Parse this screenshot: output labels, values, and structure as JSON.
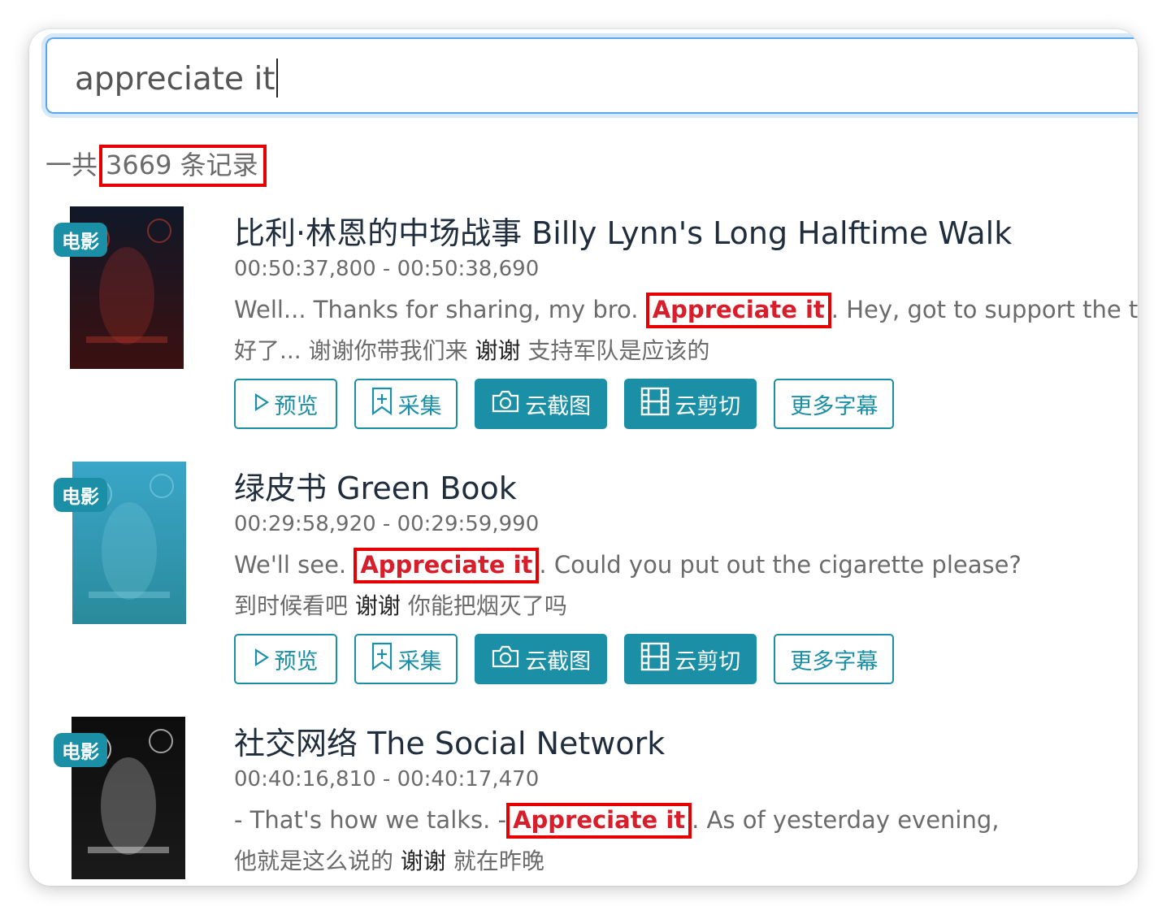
{
  "search": {
    "query": "appreciate it"
  },
  "summary": {
    "prefix": "一共",
    "count_text": "3669 条记录"
  },
  "badge_label": "电影",
  "buttons": {
    "preview": "预览",
    "collect": "采集",
    "screenshot": "云截图",
    "clip": "云剪切",
    "more": "更多字幕"
  },
  "results": [
    {
      "title": "比利·林恩的中场战事 Billy Lynn's Long Halftime Walk",
      "time": "00:50:37,800 - 00:50:38,690",
      "en_before": "Well... Thanks for sharing, my bro. ",
      "en_match": "Appreciate it",
      "en_after": ". Hey, got to support the troops.",
      "zh_before": "好了... 谢谢你带我们来 ",
      "zh_match": "谢谢",
      "zh_after": " 支持军队是应该的",
      "poster_colors": {
        "top": "#101828",
        "bottom": "#3b1010",
        "accent": "#c0392b"
      }
    },
    {
      "title": "绿皮书 Green Book",
      "time": "00:29:58,920 - 00:29:59,990",
      "en_before": "We'll see. ",
      "en_match": "Appreciate it",
      "en_after": ". Could you put out the cigarette please?",
      "zh_before": "到时候看吧 ",
      "zh_match": "谢谢",
      "zh_after": " 你能把烟灭了吗",
      "poster_colors": {
        "top": "#3aa6c8",
        "bottom": "#2a8a9c",
        "accent": "#7fd0e0"
      }
    },
    {
      "title": "社交网络 The Social Network",
      "time": "00:40:16,810 - 00:40:17,470",
      "en_before": "- That's how we talks.  -",
      "en_match": "Appreciate it",
      "en_after": ". As of yesterday evening,",
      "zh_before": "他就是这么说的 ",
      "zh_match": "谢谢",
      "zh_after": " 就在昨晚",
      "poster_colors": {
        "top": "#0d0d0d",
        "bottom": "#1a1a1a",
        "accent": "#ffffff"
      }
    }
  ]
}
